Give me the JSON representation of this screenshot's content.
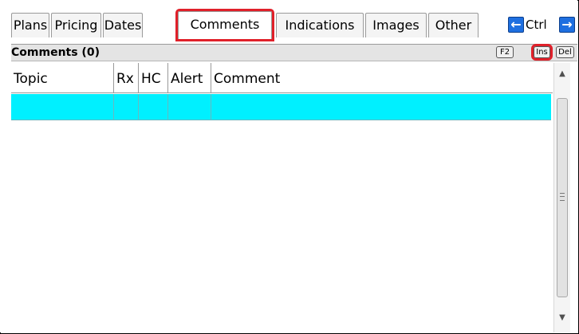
{
  "tabs": [
    {
      "label": "Plans"
    },
    {
      "label": "Pricing"
    },
    {
      "label": "Dates"
    },
    {
      "label": "Comments",
      "active": true
    },
    {
      "label": "Indications"
    },
    {
      "label": "Images"
    },
    {
      "label": "Other"
    }
  ],
  "nav": {
    "prev_icon": "arrow-left-icon",
    "ctrl_label": "Ctrl",
    "next_icon": "arrow-right-icon"
  },
  "section": {
    "title": "Comments (0)",
    "keys": [
      "F2",
      "Ins",
      "Del"
    ]
  },
  "grid": {
    "columns": [
      "Topic",
      "Rx",
      "HC",
      "Alert",
      "Comment"
    ],
    "rows": [
      [
        "",
        "",
        "",
        "",
        ""
      ]
    ],
    "selected_row_color": "#00f0ff"
  },
  "scrollbar": {
    "up_icon": "scroll-up-icon",
    "down_icon": "scroll-down-icon"
  },
  "colors": {
    "highlight": "#e0202a",
    "accent": "#1e6fe0"
  }
}
